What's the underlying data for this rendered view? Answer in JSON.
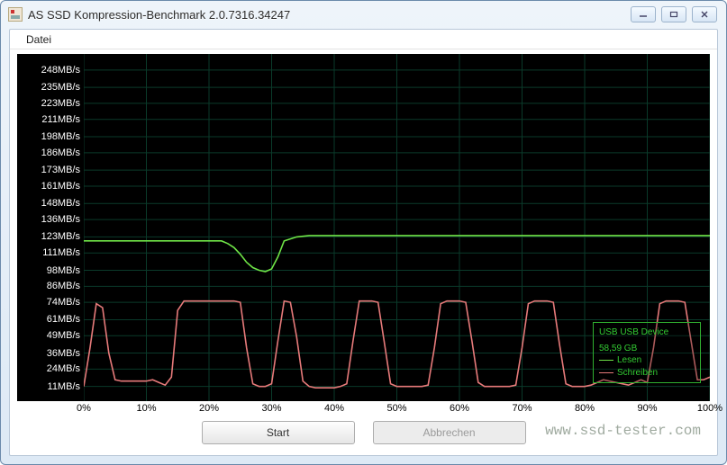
{
  "window": {
    "title": "AS SSD Kompression-Benchmark 2.0.7316.34247"
  },
  "menu": {
    "file": "Datei"
  },
  "buttons": {
    "start": "Start",
    "abort": "Abbrechen"
  },
  "legend": {
    "device": "USB USB Device",
    "capacity": "58,59 GB",
    "read_label": "Lesen",
    "write_label": "Schreiben",
    "read_color": "#6fe447",
    "write_color": "#e67a7a"
  },
  "watermark": "www.ssd-tester.com",
  "chart_data": {
    "type": "line",
    "xlabel": "",
    "ylabel": "",
    "xlim": [
      0,
      100
    ],
    "ylim": [
      0,
      260
    ],
    "x_ticks": [
      0,
      10,
      20,
      30,
      40,
      50,
      60,
      70,
      80,
      90,
      100
    ],
    "x_tick_labels": [
      "0%",
      "10%",
      "20%",
      "30%",
      "40%",
      "50%",
      "60%",
      "70%",
      "80%",
      "90%",
      "100%"
    ],
    "y_ticks": [
      11,
      24,
      36,
      49,
      61,
      74,
      86,
      98,
      111,
      123,
      136,
      148,
      161,
      173,
      186,
      198,
      211,
      223,
      235,
      248
    ],
    "y_tick_labels": [
      "11MB/s",
      "24MB/s",
      "36MB/s",
      "49MB/s",
      "61MB/s",
      "74MB/s",
      "86MB/s",
      "98MB/s",
      "111MB/s",
      "123MB/s",
      "136MB/s",
      "148MB/s",
      "161MB/s",
      "173MB/s",
      "186MB/s",
      "198MB/s",
      "211MB/s",
      "223MB/s",
      "235MB/s",
      "248MB/s"
    ],
    "series": [
      {
        "name": "Lesen",
        "color": "#6fe447",
        "x": [
          0,
          2,
          4,
          6,
          8,
          10,
          12,
          14,
          16,
          18,
          20,
          22,
          23,
          24,
          25,
          26,
          27,
          28,
          29,
          30,
          31,
          32,
          34,
          36,
          40,
          50,
          60,
          70,
          80,
          90,
          100
        ],
        "y": [
          120,
          120,
          120,
          120,
          120,
          120,
          120,
          120,
          120,
          120,
          120,
          120,
          118,
          115,
          110,
          104,
          100,
          98,
          97,
          99,
          108,
          120,
          123,
          124,
          124,
          124,
          124,
          124,
          124,
          124,
          124
        ]
      },
      {
        "name": "Schreiben",
        "color": "#e67a7a",
        "x": [
          0,
          1,
          2,
          3,
          4,
          5,
          6,
          7,
          8,
          9,
          10,
          11,
          12,
          13,
          14,
          15,
          16,
          17,
          18,
          19,
          20,
          21,
          22,
          23,
          24,
          25,
          26,
          27,
          28,
          29,
          30,
          31,
          32,
          33,
          34,
          35,
          36,
          37,
          38,
          39,
          40,
          41,
          42,
          43,
          44,
          45,
          46,
          47,
          48,
          49,
          50,
          51,
          52,
          53,
          54,
          55,
          56,
          57,
          58,
          59,
          60,
          61,
          62,
          63,
          64,
          65,
          66,
          67,
          68,
          69,
          70,
          71,
          72,
          73,
          74,
          75,
          76,
          77,
          78,
          79,
          80,
          81,
          82,
          83,
          84,
          85,
          86,
          87,
          88,
          89,
          90,
          91,
          92,
          93,
          94,
          95,
          96,
          97,
          98,
          99,
          100
        ],
        "y": [
          11,
          40,
          73,
          70,
          36,
          16,
          15,
          15,
          15,
          15,
          15,
          16,
          14,
          12,
          18,
          68,
          75,
          75,
          75,
          75,
          75,
          75,
          75,
          75,
          75,
          74,
          40,
          13,
          11,
          11,
          13,
          45,
          75,
          74,
          48,
          15,
          11,
          10,
          10,
          10,
          10,
          11,
          13,
          45,
          75,
          75,
          75,
          74,
          44,
          13,
          11,
          11,
          11,
          11,
          11,
          12,
          40,
          73,
          75,
          75,
          75,
          74,
          45,
          14,
          11,
          11,
          11,
          11,
          11,
          12,
          40,
          73,
          75,
          75,
          75,
          74,
          42,
          13,
          11,
          11,
          11,
          12,
          14,
          16,
          15,
          14,
          13,
          12,
          14,
          16,
          14,
          40,
          73,
          75,
          75,
          75,
          74,
          45,
          16,
          16,
          18
        ]
      }
    ]
  }
}
